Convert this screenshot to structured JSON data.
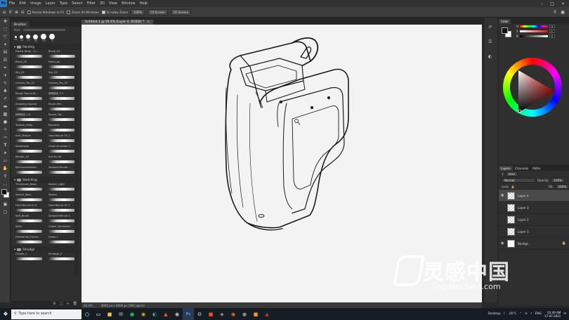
{
  "menubar": {
    "logo": "Ps",
    "items": [
      "File",
      "Edit",
      "Image",
      "Layer",
      "Type",
      "Select",
      "Filter",
      "3D",
      "View",
      "Window",
      "Help"
    ]
  },
  "options": {
    "resize_windows": "Resize Windows to Fit",
    "zoom_all": "Zoom All Windows",
    "scrubby_zoom": "Scrubby Zoom",
    "zoom_pct": "100%",
    "fit_screen": "Fit Screen",
    "fill_screen": "Fill Screen"
  },
  "document": {
    "tab_title": "Untitled-1 @ 56.4% (Layer 4, RGB/8) *",
    "close": "×"
  },
  "status": {
    "zoom": "56.4%",
    "doc_size": "4000 px x 4000 px (300 ppcm)"
  },
  "brushes": {
    "tab": "Brushes",
    "size_label": "Size:",
    "presets": [
      "15",
      "20",
      "25",
      "30",
      "50",
      "9"
    ],
    "groups": [
      {
        "name": "Painting",
        "items": [
          "Plastic Wrap - Li...",
          "Brush_01",
          "Block_05",
          "Foam_bo",
          "Sky_01",
          "Sky_02",
          "Canvas_Tex_02",
          "Canvas_Tex_03",
          "Rough Round Br...",
          "钢笔描边 3.1",
          "Amazing_Square",
          "Brush_Pen",
          "钢笔描边 1.6",
          "Round_Tex",
          "Texture_Hints",
          "Painterly",
          "Soft_Texture",
          "Hard Round 70 1",
          "Spiderweb",
          "Chalk 44 pixels 2",
          "Render_01",
          "one fur all",
          "Kyle'scommerce...",
          "Sampled Brush..."
        ]
      },
      {
        "name": "Sketching",
        "items": [
          "Thumbnail_Base",
          "Sketch_Light",
          "Sketch_Main",
          "Sketch",
          "Hard Round 50 3",
          "Hard Round 30 1",
          "Soft_Brush",
          "Sampled Brush 2",
          "Solid",
          "Colour_Dynamics",
          "Dashlands_Comm...",
          "Grass 1"
        ]
      },
      {
        "name": "Smudge",
        "items": [
          "Clouds_1",
          "Smudge_2"
        ]
      }
    ]
  },
  "color_panel": {
    "tab": "Color",
    "labels": [
      "H",
      "S",
      "B"
    ],
    "values": [
      "0",
      "0",
      "0"
    ],
    "foreground": "#111111",
    "background": "#ffffff"
  },
  "layers_panel": {
    "tabs": [
      "Layers",
      "Channels",
      "Paths"
    ],
    "kind": "Kind",
    "mode": "Normal",
    "opacity_label": "Opacity:",
    "opacity": "100%",
    "lock_label": "Lock:",
    "fill_label": "Fill:",
    "fill": "100%",
    "layers": [
      "Layer 4",
      "Layer 3",
      "Layer 2",
      "Layer 1",
      "Backgr..."
    ]
  },
  "taskbar": {
    "search": "Type here to search",
    "desktop": "Desktop",
    "weather": "26°C",
    "lang": "ENG",
    "time": "01:49 AM",
    "date": "17-07-2021"
  },
  "watermark": {
    "title": "灵感中国",
    "url": "lingganchina.com"
  },
  "icons": {
    "tools": [
      "move-icon",
      "marquee-icon",
      "lasso-icon",
      "magic-wand-icon",
      "crop-icon",
      "frame-icon",
      "eyedropper-icon",
      "healing-brush-icon",
      "brush-icon",
      "clone-stamp-icon",
      "history-brush-icon",
      "eraser-icon",
      "gradient-icon",
      "blur-icon",
      "dodge-icon",
      "pen-icon",
      "type-icon",
      "path-selection-icon",
      "rectangle-icon",
      "hand-icon",
      "zoom-icon"
    ]
  }
}
